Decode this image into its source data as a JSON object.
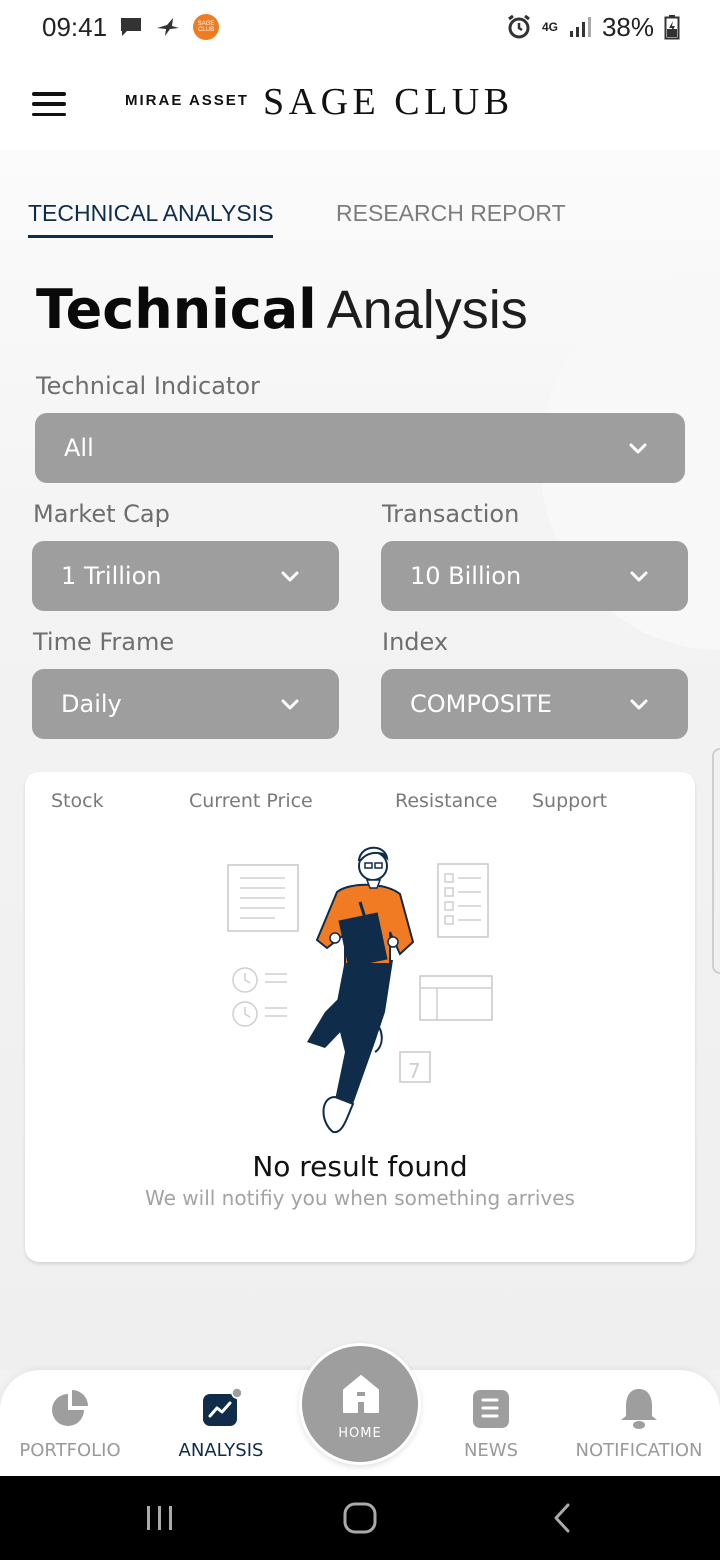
{
  "status_bar": {
    "time": "09:41",
    "app_badge": "SAGE CLUB",
    "network": "4G",
    "battery": "38%"
  },
  "header": {
    "brand_small": "MIRAE ASSET",
    "brand_large": "SAGE CLUB"
  },
  "tabs": [
    {
      "label": "TECHNICAL ANALYSIS",
      "active": true
    },
    {
      "label": "RESEARCH REPORT",
      "active": false
    }
  ],
  "page_title": {
    "bold": "Technical",
    "light": "Analysis"
  },
  "filters": {
    "technical_indicator": {
      "label": "Technical Indicator",
      "value": "All"
    },
    "market_cap": {
      "label": "Market Cap",
      "value": "1 Trillion"
    },
    "transaction": {
      "label": "Transaction",
      "value": "10 Billion"
    },
    "time_frame": {
      "label": "Time Frame",
      "value": "Daily"
    },
    "index": {
      "label": "Index",
      "value": "COMPOSITE"
    }
  },
  "table": {
    "columns": [
      "Stock",
      "Current Price",
      "Resistance",
      "Support"
    ],
    "empty_title": "No result found",
    "empty_subtitle": "We will notifiy you when something arrives"
  },
  "bottom_nav": {
    "items": [
      {
        "label": "PORTFOLIO",
        "icon": "pie-chart-icon",
        "active": false
      },
      {
        "label": "ANALYSIS",
        "icon": "trend-chart-icon",
        "active": true
      },
      {
        "label": "NEWS",
        "icon": "news-icon",
        "active": false
      },
      {
        "label": "NOTIFICATION",
        "icon": "bell-icon",
        "active": false
      }
    ],
    "home_label": "HOME"
  },
  "colors": {
    "accent": "#0f2d4a",
    "select_bg": "#9e9e9e",
    "illustration_orange": "#f07b22"
  }
}
